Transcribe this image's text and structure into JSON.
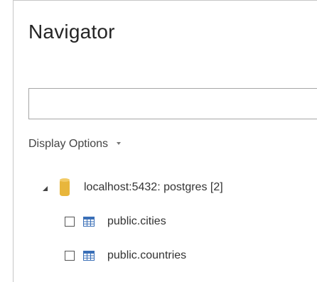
{
  "navigator": {
    "title": "Navigator",
    "search": {
      "value": "",
      "placeholder": ""
    },
    "display_options_label": "Display Options",
    "tree": {
      "server": {
        "label": "localhost:5432: postgres [2]",
        "expanded": true,
        "icon": "database-icon"
      },
      "tables": [
        {
          "label": "public.cities",
          "checked": false,
          "icon": "table-icon"
        },
        {
          "label": "public.countries",
          "checked": false,
          "icon": "table-icon"
        }
      ]
    }
  },
  "colors": {
    "database": "#e8b63c",
    "table_icon": "#3a6fb7",
    "border": "#c6c6c6"
  }
}
